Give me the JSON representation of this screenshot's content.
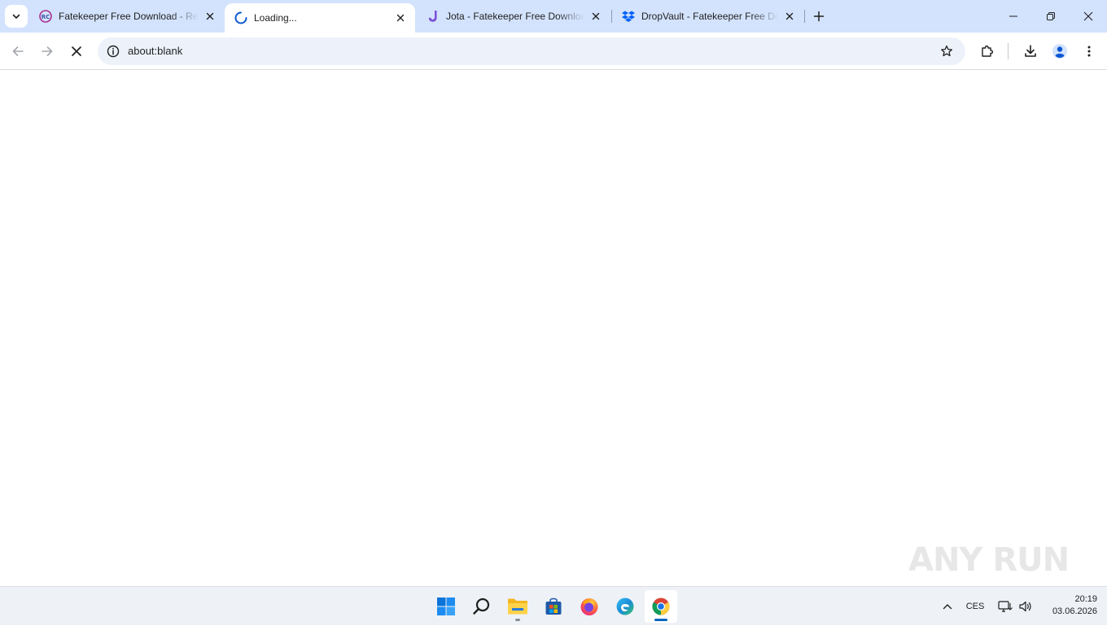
{
  "browser": {
    "tabs": [
      {
        "title": "Fatekeeper Free Download - Rep",
        "favicon": "rc-badge-icon",
        "active": false
      },
      {
        "title": "Loading...",
        "favicon": "loading-spinner-icon",
        "active": true
      },
      {
        "title": "Jota - Fatekeeper Free Download",
        "favicon": "jota-logo-icon",
        "active": false
      },
      {
        "title": "DropVault - Fatekeeper Free Download",
        "favicon": "dropbox-icon",
        "active": false
      }
    ],
    "address_bar": {
      "url": "about:blank"
    }
  },
  "watermark": {
    "text": "ANY RUN"
  },
  "taskbar": {
    "apps": [
      "windows-start-icon",
      "search-icon",
      "file-explorer-icon",
      "microsoft-store-icon",
      "firefox-icon",
      "edge-icon",
      "chrome-icon"
    ],
    "tray": {
      "language": "CES",
      "time": "20:19",
      "date": "03.06.2026"
    }
  },
  "colors": {
    "tabstrip": "#d3e3fd",
    "omnibox": "#edf2fa",
    "accent": "#0b57d0",
    "taskbar": "#eef1f6"
  }
}
